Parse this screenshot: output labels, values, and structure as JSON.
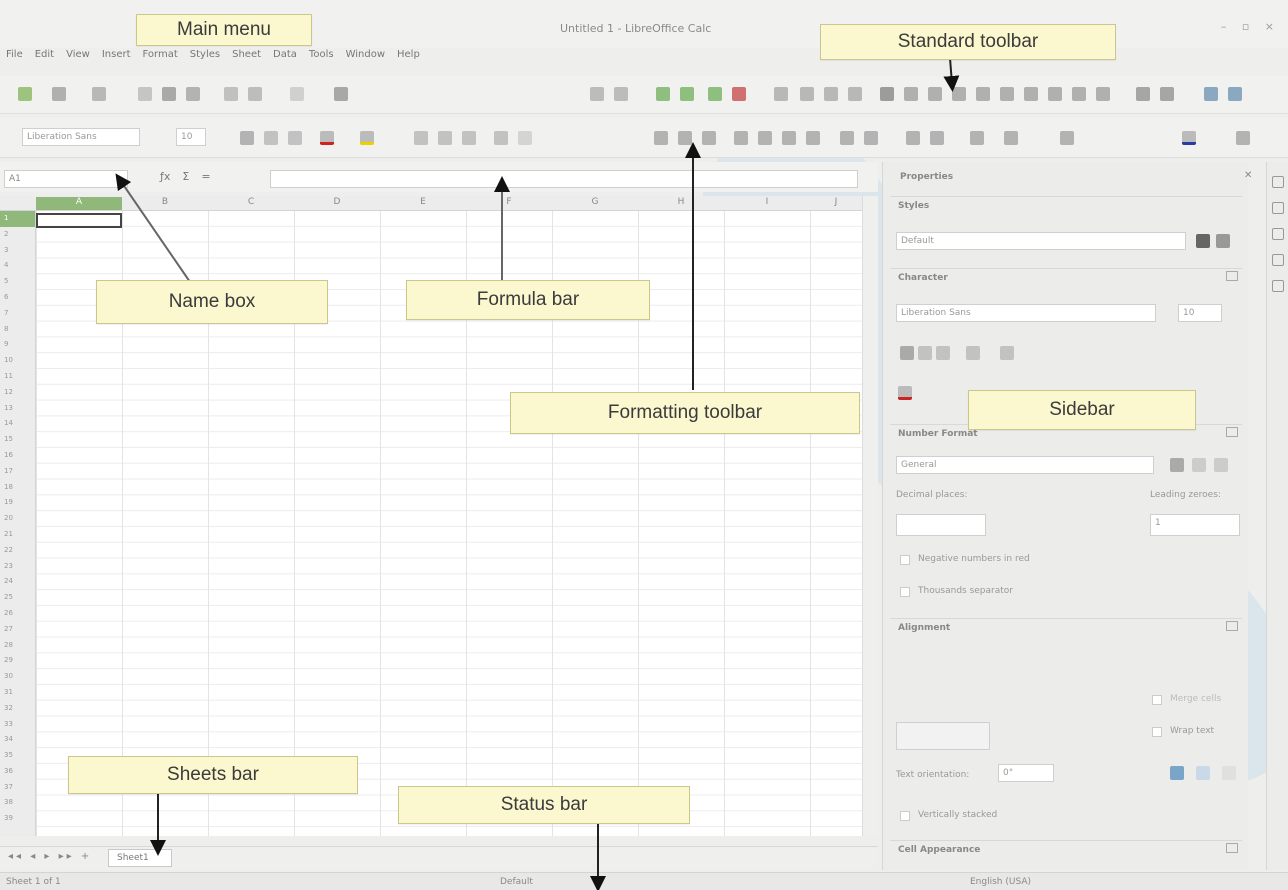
{
  "window": {
    "title": "Untitled 1 - LibreOffice Calc",
    "controls": "– ▫ ×"
  },
  "menu": [
    "File",
    "Edit",
    "View",
    "Insert",
    "Format",
    "Styles",
    "Sheet",
    "Data",
    "Tools",
    "Window",
    "Help"
  ],
  "formatting": {
    "font_name": "Liberation Sans",
    "font_size": "10"
  },
  "formula_bar": {
    "name_box": "A1",
    "value": ""
  },
  "grid": {
    "columns": [
      "A",
      "B",
      "C",
      "D",
      "E",
      "F",
      "G",
      "H",
      "I",
      "J"
    ],
    "rows": [
      "1",
      "2",
      "3",
      "4",
      "5",
      "6",
      "7",
      "8",
      "9",
      "10",
      "11",
      "12",
      "13",
      "14",
      "15",
      "16",
      "17",
      "18",
      "19",
      "20",
      "21",
      "22",
      "23",
      "24",
      "25",
      "26",
      "27",
      "28",
      "29",
      "30",
      "31",
      "32",
      "33",
      "34",
      "35",
      "36",
      "37",
      "38",
      "39"
    ]
  },
  "sheets": {
    "tab": "Sheet1"
  },
  "status": {
    "sheet_info": "Sheet 1 of 1",
    "style": "Default",
    "language": "English (USA)"
  },
  "sidebar": {
    "title": "Properties",
    "styles_section": "Styles",
    "style_value": "Default",
    "character_section": "Character",
    "font_value": "Liberation Sans",
    "font_size": "10",
    "number_format_section": "Number Format",
    "number_format_value": "General",
    "decimal_places_label": "Decimal places:",
    "leading_zeroes_label": "Leading zeroes:",
    "decimal_places_value": "",
    "leading_zeroes_value": "1",
    "negative_red_label": "Negative numbers in red",
    "thousands_sep_label": "Thousands separator",
    "alignment_section": "Alignment",
    "merge_cells_label": "Merge cells",
    "wrap_text_label": "Wrap text",
    "text_orientation_label": "Text orientation:",
    "text_orientation_value": "0°",
    "vertically_stacked_label": "Vertically stacked",
    "cell_appearance_section": "Cell Appearance"
  },
  "callouts": {
    "main_menu": "Main menu",
    "standard_toolbar": "Standard toolbar",
    "name_box": "Name box",
    "formula_bar": "Formula bar",
    "formatting_toolbar": "Formatting toolbar",
    "sidebar": "Sidebar",
    "sheets_bar": "Sheets bar",
    "status_bar": "Status bar"
  },
  "colors": {
    "callout_bg": "#fbf8cf",
    "active_header": "#8fb87a",
    "font_color_underline": "#cc2222",
    "highlight_underline": "#e8d200"
  }
}
